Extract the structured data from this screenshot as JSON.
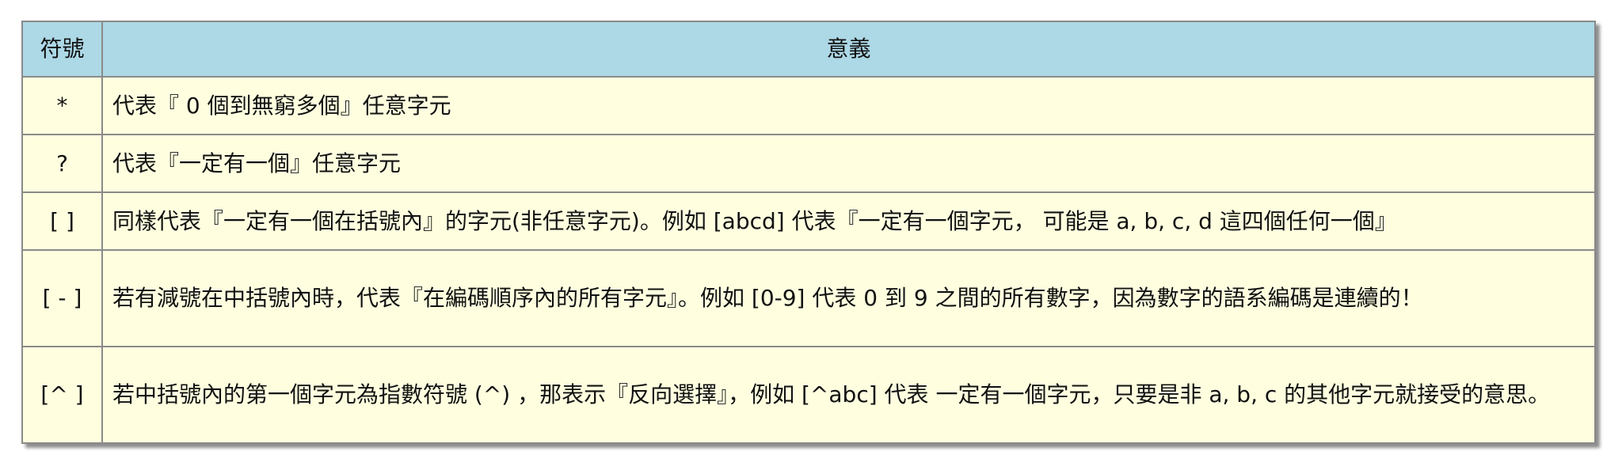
{
  "table": {
    "headers": [
      "符號",
      "意義"
    ],
    "rows": [
      {
        "symbol": "*",
        "meaning": "代表『 0 個到無窮多個』任意字元"
      },
      {
        "symbol": "?",
        "meaning": "代表『一定有一個』任意字元"
      },
      {
        "symbol": "[ ]",
        "meaning": "同樣代表『一定有一個在括號內』的字元(非任意字元)。例如 [abcd] 代表『一定有一個字元， 可能是 a, b, c, d 這四個任何一個』"
      },
      {
        "symbol": "[ - ]",
        "meaning": "若有減號在中括號內時，代表『在編碼順序內的所有字元』。例如 [0-9] 代表 0 到 9 之間的所有數字，因為數字的語系編碼是連續的！"
      },
      {
        "symbol": "[^ ]",
        "meaning": "若中括號內的第一個字元為指數符號 (^) ，那表示『反向選擇』，例如 [^abc] 代表 一定有一個字元，只要是非 a, b, c 的其他字元就接受的意思。"
      }
    ]
  },
  "colors": {
    "header_bg": "#add8e6",
    "cell_bg": "#ffffe0",
    "border": "#8a8a8a"
  }
}
